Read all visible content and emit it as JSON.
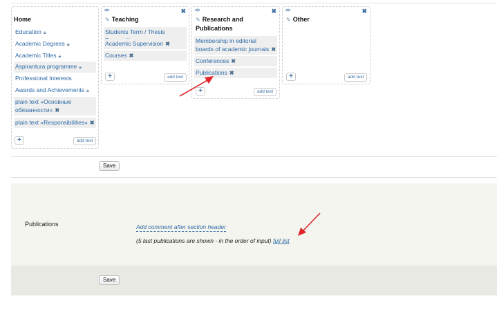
{
  "columns": {
    "home": {
      "title": "Home",
      "items": [
        {
          "label": "Education",
          "locked": true
        },
        {
          "label": "Academic Degrees",
          "locked": true
        },
        {
          "label": "Academic Titles",
          "locked": true
        },
        {
          "label": "Aspirantura programme",
          "locked": true
        },
        {
          "label": "Professional Interests"
        },
        {
          "label": "Awards and Achievements",
          "locked": true
        },
        {
          "label": "plain text «Основные обязанности»",
          "removable": true
        },
        {
          "label": "plain text «Responsibilities»",
          "removable": true
        }
      ],
      "add_text": "add text"
    },
    "teaching": {
      "title": "Teaching",
      "items": [
        {
          "label": "Students Term / Thesis Papers",
          "removable": true
        },
        {
          "label": "Academic Supervision",
          "removable": true
        },
        {
          "label": "Courses",
          "removable": true
        }
      ],
      "add_text": "add text"
    },
    "research": {
      "title": "Research and Publications",
      "items": [
        {
          "label": "Membership in editorial boards of academic journals",
          "removable": true
        },
        {
          "label": "Conferences",
          "removable": true
        },
        {
          "label": "Publications",
          "removable": true
        }
      ],
      "add_text": "add text"
    },
    "other": {
      "title": "Other",
      "items": [],
      "add_text": "add text"
    }
  },
  "icons": {
    "move": "move-icon",
    "close": "close-icon",
    "edit": "pencil-icon",
    "lock": "lock-icon",
    "remove": "x-icon",
    "add": "plus-icon"
  },
  "save_label": "Save",
  "publications": {
    "label": "Publications",
    "comment_link": "Add comment after section header",
    "note": "(5 last publications are shown - in the order of input)",
    "full_list": "full list"
  },
  "colors": {
    "link": "#2d6aa6",
    "arrow": "#e0262a",
    "section_bg": "#f5f5ef"
  }
}
